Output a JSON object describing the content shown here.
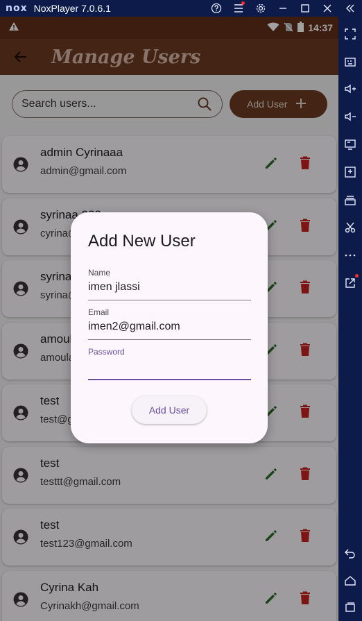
{
  "emulator": {
    "logo": "nox",
    "title": "NoxPlayer 7.0.6.1",
    "controls": [
      "help-icon",
      "menu-icon",
      "settings-icon",
      "minimize-icon",
      "maximize-icon",
      "close-icon",
      "collapse-icon"
    ],
    "side_tools": [
      "fullscreen-icon",
      "keyboard-icon",
      "volume-up-icon",
      "volume-down-icon",
      "screen-icon",
      "apk-install-icon",
      "multi-instance-icon",
      "scissors-icon",
      "more-icon",
      "external-link-icon",
      "back-icon",
      "home-icon",
      "recents-icon"
    ]
  },
  "status_bar": {
    "time": "14:37",
    "icons": [
      "warning-icon",
      "wifi-icon",
      "no-sim-icon",
      "battery-icon"
    ]
  },
  "app_bar": {
    "title": "Manage Users",
    "back_icon": "back-arrow-icon"
  },
  "search": {
    "placeholder": "Search users..."
  },
  "add_button": {
    "label": "Add User",
    "icon": "plus-icon"
  },
  "users": [
    {
      "name": "admin Cyrinaaa",
      "email": "admin@gmail.com"
    },
    {
      "name": "syrinaa 222",
      "email": "cyrina@gmail.com"
    },
    {
      "name": "syrina",
      "email": "syrina@gmail.com"
    },
    {
      "name": " amoula",
      "email": "amoula@gmail.com"
    },
    {
      "name": "test",
      "email": "test@gmail.com"
    },
    {
      "name": "test",
      "email": "testtt@gmail.com"
    },
    {
      "name": "test",
      "email": "test123@gmail.com"
    },
    {
      "name": "Cyrina Kah",
      "email": "Cyrinakh@gmail.com"
    }
  ],
  "dialog": {
    "title": "Add New User",
    "fields": [
      {
        "label": "Name",
        "value": "imen jlassi"
      },
      {
        "label": "Email",
        "value": "imen2@gmail.com"
      },
      {
        "label": "Password",
        "value": ""
      }
    ],
    "submit_label": "Add User"
  },
  "colors": {
    "app_bar": "#6b3a22",
    "status_bar": "#5f2f1a",
    "edit_icon": "#2f6b2a",
    "delete_icon": "#c62222",
    "accent": "#6750a4",
    "emulator_frame": "#0d1b4a"
  }
}
